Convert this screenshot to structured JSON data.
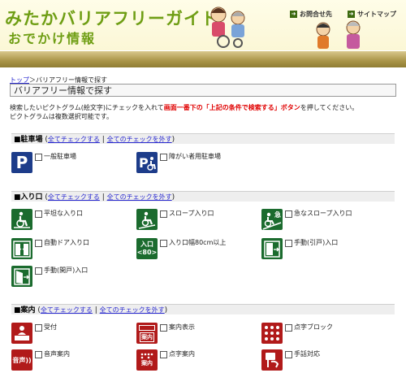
{
  "header": {
    "logo_line1": "みたかバリアフリーガイド",
    "logo_line2": "おでかけ情報",
    "contact": "お問合せ先",
    "sitemap": "サイトマップ"
  },
  "breadcrumb": {
    "top": "トップ",
    "sep": "＞",
    "current": "バリアフリー情報で探す"
  },
  "page_title": "バリアフリー情報で探す",
  "intro": {
    "part1": "検索したいピクトグラム(絵文字)にチェックを入れて",
    "highlight": "画面一番下の「上記の条件で検索する」ボタン",
    "part2": "を押してください。",
    "line2": "ピクトグラムは複数選択可能です。"
  },
  "check_all": "全てチェックする",
  "uncheck_all": "全てのチェックを外す",
  "sections": {
    "parking": {
      "title": "■駐車場",
      "items": [
        "一般駐車場",
        "障がい者用駐車場"
      ]
    },
    "entrance": {
      "title": "■入り口",
      "items": [
        "平坦な入り口",
        "スロープ入り口",
        "急なスロープ入り口",
        "自動ドア入り口",
        "入り口幅80cm以上",
        "手動(引戸)入口",
        "手動(開戸)入口"
      ]
    },
    "info": {
      "title": "■案内",
      "items": [
        "受付",
        "案内表示",
        "点字ブロック",
        "音声案内",
        "点字案内",
        "手話対応"
      ]
    }
  },
  "icon_text": {
    "parking": "P",
    "entrance_width": "入口",
    "width_80": "<80>",
    "info_sign": "案内",
    "audio": "音声",
    "braille": "案内",
    "steep": "急"
  },
  "colors": {
    "parking": "#1d3c8a",
    "entrance": "#1b6b2e",
    "info": "#b11a1a",
    "brand_green": "#6f9e14",
    "highlight": "#e00000"
  }
}
